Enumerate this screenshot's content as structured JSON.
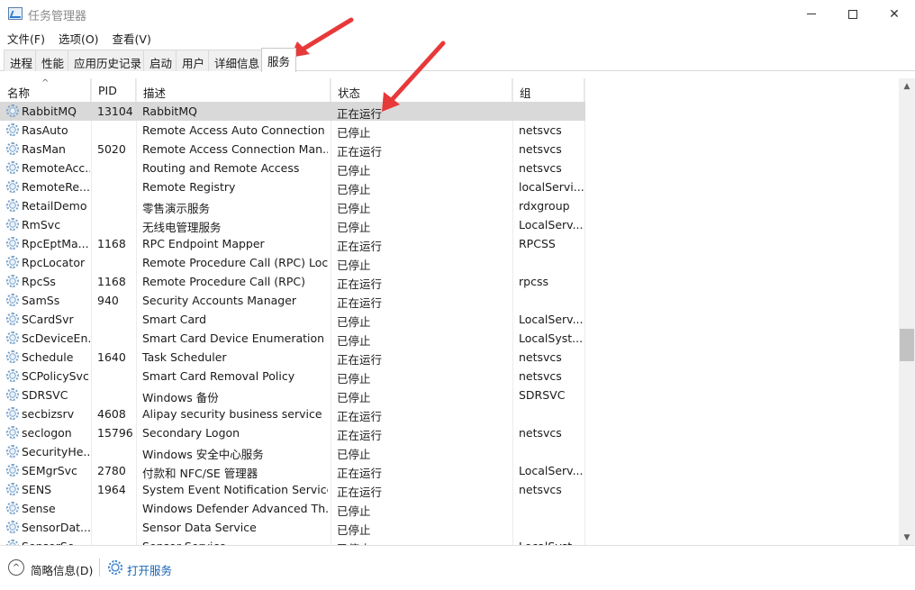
{
  "window": {
    "title": "任务管理器",
    "minimize_glyph": "—",
    "close_glyph": "✕"
  },
  "menu": [
    {
      "label": "文件(F)"
    },
    {
      "label": "选项(O)"
    },
    {
      "label": "查看(V)"
    }
  ],
  "tabs": [
    {
      "label": "进程",
      "active": false
    },
    {
      "label": "性能",
      "active": false
    },
    {
      "label": "应用历史记录",
      "active": false
    },
    {
      "label": "启动",
      "active": false
    },
    {
      "label": "用户",
      "active": false
    },
    {
      "label": "详细信息",
      "active": false
    },
    {
      "label": "服务",
      "active": true
    }
  ],
  "columns": {
    "name": "名称",
    "pid": "PID",
    "desc": "描述",
    "status": "状态",
    "group": "组",
    "sort_indicator": "^"
  },
  "rows": [
    {
      "name": "RabbitMQ",
      "pid": "13104",
      "desc": "RabbitMQ",
      "status": "正在运行",
      "group": "",
      "selected": true
    },
    {
      "name": "RasAuto",
      "pid": "",
      "desc": "Remote Access Auto Connection ...",
      "status": "已停止",
      "group": "netsvcs"
    },
    {
      "name": "RasMan",
      "pid": "5020",
      "desc": "Remote Access Connection Man...",
      "status": "正在运行",
      "group": "netsvcs"
    },
    {
      "name": "RemoteAcc...",
      "pid": "",
      "desc": "Routing and Remote Access",
      "status": "已停止",
      "group": "netsvcs"
    },
    {
      "name": "RemoteRe...",
      "pid": "",
      "desc": "Remote Registry",
      "status": "已停止",
      "group": "localServi..."
    },
    {
      "name": "RetailDemo",
      "pid": "",
      "desc": "零售演示服务",
      "status": "已停止",
      "group": "rdxgroup"
    },
    {
      "name": "RmSvc",
      "pid": "",
      "desc": "无线电管理服务",
      "status": "已停止",
      "group": "LocalServ..."
    },
    {
      "name": "RpcEptMa...",
      "pid": "1168",
      "desc": "RPC Endpoint Mapper",
      "status": "正在运行",
      "group": "RPCSS"
    },
    {
      "name": "RpcLocator",
      "pid": "",
      "desc": "Remote Procedure Call (RPC) Loc...",
      "status": "已停止",
      "group": ""
    },
    {
      "name": "RpcSs",
      "pid": "1168",
      "desc": "Remote Procedure Call (RPC)",
      "status": "正在运行",
      "group": "rpcss"
    },
    {
      "name": "SamSs",
      "pid": "940",
      "desc": "Security Accounts Manager",
      "status": "正在运行",
      "group": ""
    },
    {
      "name": "SCardSvr",
      "pid": "",
      "desc": "Smart Card",
      "status": "已停止",
      "group": "LocalServ..."
    },
    {
      "name": "ScDeviceEn...",
      "pid": "",
      "desc": "Smart Card Device Enumeration ...",
      "status": "已停止",
      "group": "LocalSyst..."
    },
    {
      "name": "Schedule",
      "pid": "1640",
      "desc": "Task Scheduler",
      "status": "正在运行",
      "group": "netsvcs"
    },
    {
      "name": "SCPolicySvc",
      "pid": "",
      "desc": "Smart Card Removal Policy",
      "status": "已停止",
      "group": "netsvcs"
    },
    {
      "name": "SDRSVC",
      "pid": "",
      "desc": "Windows 备份",
      "status": "已停止",
      "group": "SDRSVC"
    },
    {
      "name": "secbizsrv",
      "pid": "4608",
      "desc": "Alipay security business service",
      "status": "正在运行",
      "group": ""
    },
    {
      "name": "seclogon",
      "pid": "15796",
      "desc": "Secondary Logon",
      "status": "正在运行",
      "group": "netsvcs"
    },
    {
      "name": "SecurityHe...",
      "pid": "",
      "desc": "Windows 安全中心服务",
      "status": "已停止",
      "group": ""
    },
    {
      "name": "SEMgrSvc",
      "pid": "2780",
      "desc": "付款和 NFC/SE 管理器",
      "status": "正在运行",
      "group": "LocalServ..."
    },
    {
      "name": "SENS",
      "pid": "1964",
      "desc": "System Event Notification Service",
      "status": "正在运行",
      "group": "netsvcs"
    },
    {
      "name": "Sense",
      "pid": "",
      "desc": "Windows Defender Advanced Th...",
      "status": "已停止",
      "group": ""
    },
    {
      "name": "SensorDat...",
      "pid": "",
      "desc": "Sensor Data Service",
      "status": "已停止",
      "group": ""
    },
    {
      "name": "SensorSe...",
      "pid": "",
      "desc": "Sensor Service",
      "status": "已停止",
      "group": "LocalSyst..."
    }
  ],
  "scrollbar": {
    "up_glyph": "▲",
    "down_glyph": "▼"
  },
  "footer": {
    "fewer_details": "简略信息(D)",
    "fewer_glyph": "^",
    "open_services": "打开服务"
  },
  "colors": {
    "selected_row": "#d9d9d9",
    "link": "#1664b5",
    "annotation_arrow": "#e8393a"
  }
}
